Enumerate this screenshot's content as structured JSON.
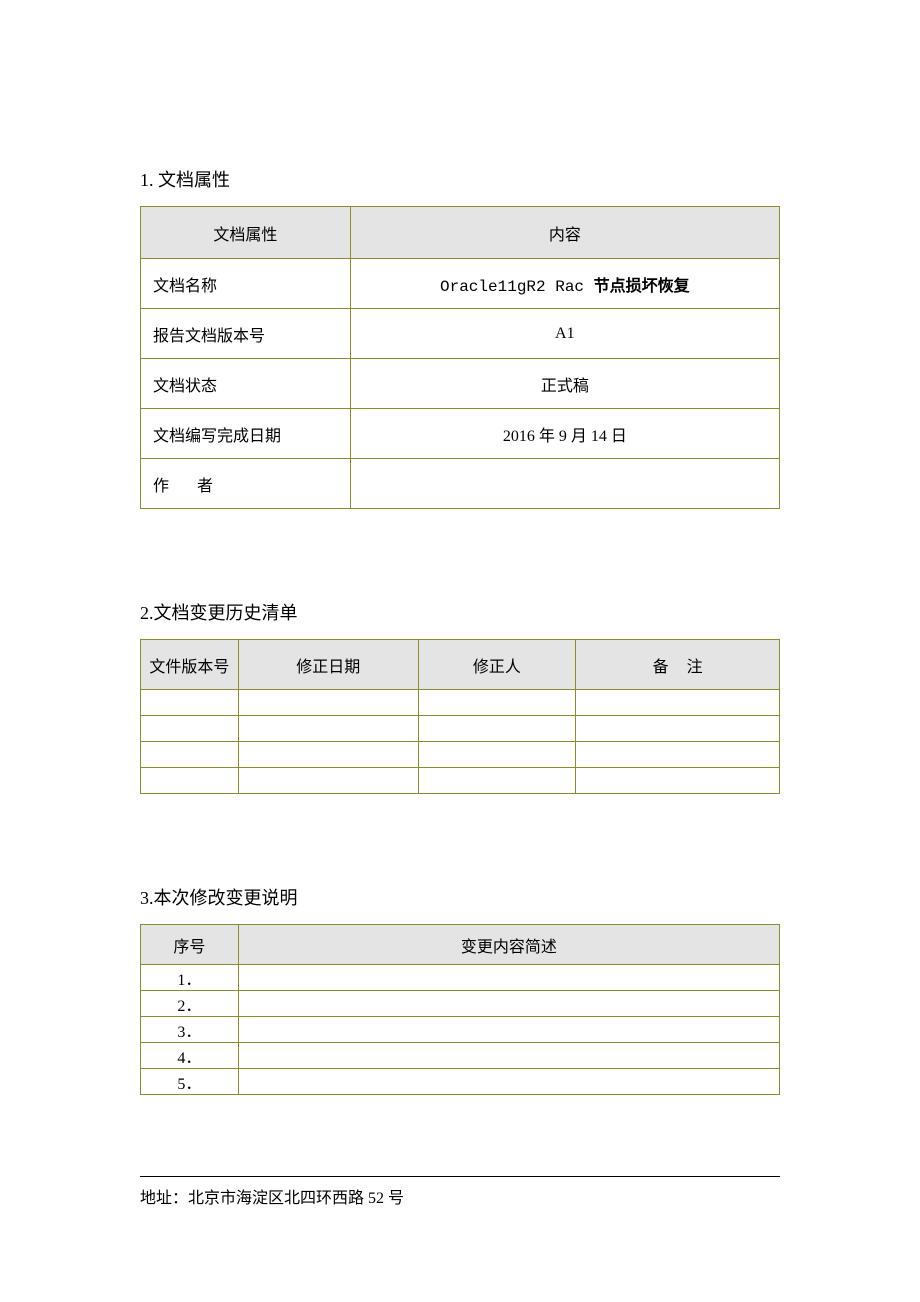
{
  "sections": {
    "s1_title": "1.  文档属性",
    "s2_title": "2.文档变更历史清单",
    "s3_title": "3.本次修改变更说明"
  },
  "table1": {
    "header_left": "文档属性",
    "header_right": "内容",
    "rows": [
      {
        "label": "文档名称",
        "value_prefix": "Oracle11gR2 Rac ",
        "value_bold": "节点损坏恢复"
      },
      {
        "label": "报告文档版本号",
        "value": "A1"
      },
      {
        "label": "文档状态",
        "value": "正式稿"
      },
      {
        "label": "文档编写完成日期",
        "value": "2016 年 9 月 14 日"
      },
      {
        "label_author_left": "作",
        "label_author_right": "者",
        "value": ""
      }
    ]
  },
  "table2": {
    "headers": {
      "c1": "文件版本号",
      "c2": "修正日期",
      "c3": "修正人",
      "c4_a": "备",
      "c4_b": "注"
    },
    "rows": [
      {
        "c1": "",
        "c2": "",
        "c3": "",
        "c4": ""
      },
      {
        "c1": "",
        "c2": "",
        "c3": "",
        "c4": ""
      },
      {
        "c1": "",
        "c2": "",
        "c3": "",
        "c4": ""
      },
      {
        "c1": "",
        "c2": "",
        "c3": "",
        "c4": ""
      }
    ]
  },
  "table3": {
    "headers": {
      "c1": "序号",
      "c2": "变更内容简述"
    },
    "rows": [
      {
        "c1": "1．",
        "c2": ""
      },
      {
        "c1": "2．",
        "c2": ""
      },
      {
        "c1": "3．",
        "c2": ""
      },
      {
        "c1": "4．",
        "c2": ""
      },
      {
        "c1": "5．",
        "c2": ""
      }
    ]
  },
  "footer": "地址：北京市海淀区北四环西路 52 号"
}
